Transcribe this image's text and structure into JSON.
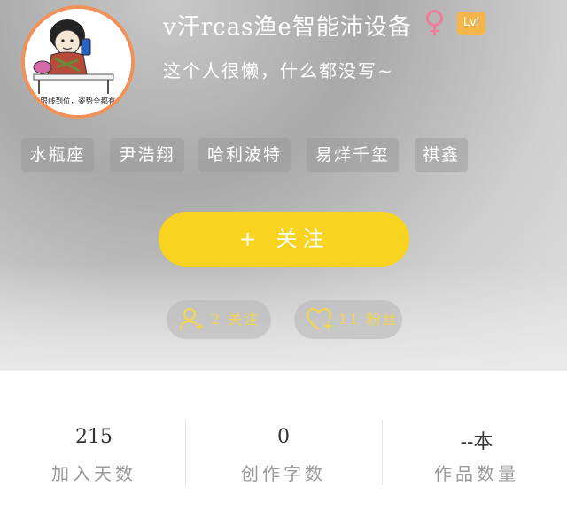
{
  "profile": {
    "username": "v汗rcas渔e智能沛设备",
    "gender_symbol": "♀",
    "level": "Lvl",
    "bio": "这个人很懒，什么都没写~",
    "avatar_caption": "眼线到位，姿势全都有"
  },
  "tags": [
    "水瓶座",
    "尹浩翔",
    "哈利波特",
    "易烊千玺",
    "祺鑫"
  ],
  "follow_button": {
    "icon": "+",
    "label": "关注"
  },
  "social": {
    "following": {
      "icon": "person-add-icon",
      "text": "2 关注"
    },
    "fans": {
      "icon": "heart-add-icon",
      "text": "11 粉丝"
    }
  },
  "stats": [
    {
      "value": "215",
      "label": "加入天数"
    },
    {
      "value": "0",
      "label": "创作字数"
    },
    {
      "value": "--本",
      "label": "作品数量"
    }
  ],
  "colors": {
    "accent_yellow": "#f8d31f",
    "avatar_border": "#f1915a",
    "gender_pink": "#f07a9a",
    "level_orange": "#f4b64a",
    "stat_label": "#9a9a9a"
  }
}
